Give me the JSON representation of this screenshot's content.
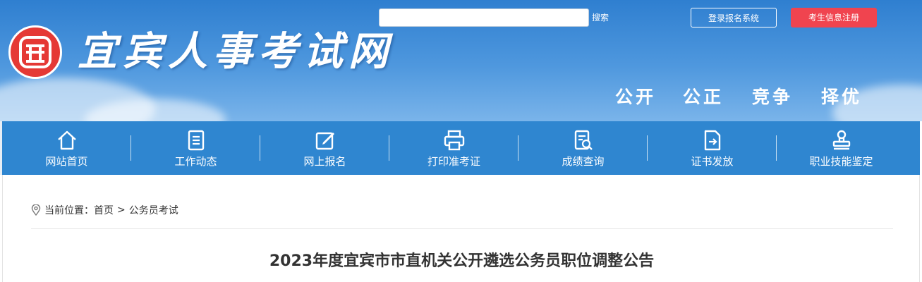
{
  "header": {
    "site_title": "宜宾人事考试网",
    "search_placeholder": "",
    "search_label": "搜索",
    "login_label": "登录报名系统",
    "register_label": "考生信息注册",
    "slogans": [
      "公开",
      "公正",
      "竞争",
      "择优"
    ]
  },
  "nav": {
    "items": [
      {
        "label": "网站首页",
        "icon": "home-icon"
      },
      {
        "label": "工作动态",
        "icon": "document-icon"
      },
      {
        "label": "网上报名",
        "icon": "edit-icon"
      },
      {
        "label": "打印准考证",
        "icon": "printer-icon"
      },
      {
        "label": "成绩查询",
        "icon": "search-document-icon"
      },
      {
        "label": "证书发放",
        "icon": "certificate-export-icon"
      },
      {
        "label": "职业技能鉴定",
        "icon": "stamp-icon"
      }
    ]
  },
  "breadcrumb": {
    "prefix": "当前位置：",
    "items": [
      "首页",
      "公务员考试"
    ],
    "separator": ">"
  },
  "article": {
    "title": "2023年度宜宾市市直机关公开遴选公务员职位调整公告"
  },
  "colors": {
    "banner": "#3a88d6",
    "nav": "#2f86d0",
    "register_button": "#f0444f",
    "logo_red": "#e53935"
  }
}
